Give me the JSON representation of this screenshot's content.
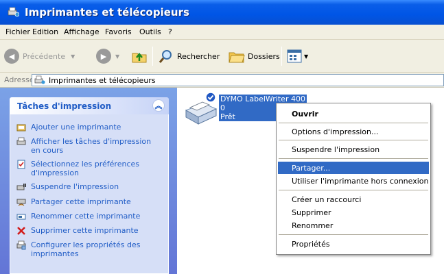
{
  "window": {
    "title": "Imprimantes et télécopieurs"
  },
  "menu": [
    "Fichier",
    "Edition",
    "Affichage",
    "Favoris",
    "Outils",
    "?"
  ],
  "toolbar": {
    "back": "Précédente",
    "search": "Rechercher",
    "folders": "Dossiers"
  },
  "address": {
    "label": "Adresse",
    "value": "Imprimantes et télécopieurs"
  },
  "tasks": {
    "header": "Tâches d'impression",
    "items": [
      {
        "label": "Ajouter une imprimante",
        "icon": "add-printer-icon"
      },
      {
        "label": "Afficher les tâches d'impression en cours",
        "icon": "print-queue-icon"
      },
      {
        "label": "Sélectionnez les préférences d'impression",
        "icon": "preferences-icon"
      },
      {
        "label": "Suspendre l'impression",
        "icon": "pause-printing-icon"
      },
      {
        "label": "Partager cette imprimante",
        "icon": "share-printer-icon"
      },
      {
        "label": "Renommer cette imprimante",
        "icon": "rename-icon"
      },
      {
        "label": "Supprimer cette imprimante",
        "icon": "delete-icon"
      },
      {
        "label": "Configurer les propriétés des imprimantes",
        "icon": "properties-icon"
      }
    ]
  },
  "printer": {
    "name": "DYMO LabelWriter 400",
    "jobs": "0",
    "status": "Prêt"
  },
  "context_menu": [
    "Ouvrir",
    "Options d'impression...",
    "Suspendre l'impression",
    "Partager...",
    "Utiliser l'imprimante hors connexion",
    "Créer un raccourci",
    "Supprimer",
    "Renommer",
    "Propriétés"
  ],
  "colors": {
    "titlebar": "#0055e6",
    "task_text": "#215dc6",
    "selection": "#316ac5",
    "pane": "#6f8fdf"
  }
}
